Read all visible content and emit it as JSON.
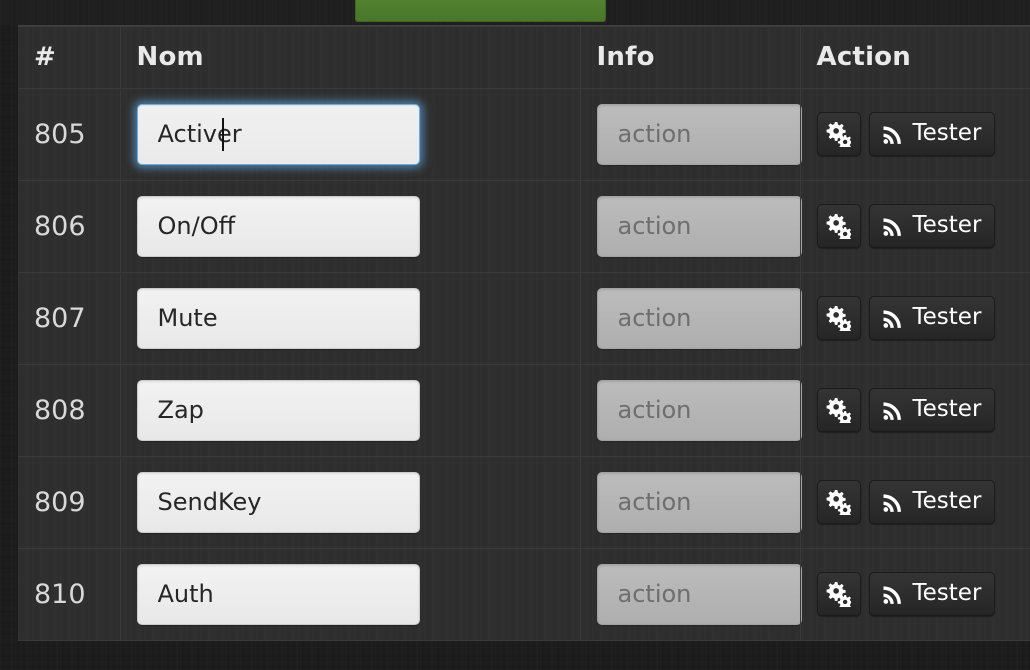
{
  "page": {
    "background_color": "#1b1b1b",
    "accent_green": "#4d7b2f",
    "focus_blue": "#66afe9"
  },
  "top_bar": {
    "green_tab_label": ""
  },
  "table": {
    "columns": [
      {
        "key": "id",
        "label": "#"
      },
      {
        "key": "nom",
        "label": "Nom"
      },
      {
        "key": "info",
        "label": "Info"
      },
      {
        "key": "action",
        "label": "Action"
      }
    ],
    "rows": [
      {
        "id": "805",
        "nom_value": "Activer",
        "nom_focused": true,
        "info_value": "",
        "info_placeholder": "action",
        "info_disabled": true,
        "settings_icon": "cogs-icon",
        "test_label": "Tester",
        "test_icon": "rss-icon"
      },
      {
        "id": "806",
        "nom_value": "On/Off",
        "nom_focused": false,
        "info_value": "",
        "info_placeholder": "action",
        "info_disabled": true,
        "settings_icon": "cogs-icon",
        "test_label": "Tester",
        "test_icon": "rss-icon"
      },
      {
        "id": "807",
        "nom_value": "Mute",
        "nom_focused": false,
        "info_value": "",
        "info_placeholder": "action",
        "info_disabled": true,
        "settings_icon": "cogs-icon",
        "test_label": "Tester",
        "test_icon": "rss-icon"
      },
      {
        "id": "808",
        "nom_value": "Zap",
        "nom_focused": false,
        "info_value": "",
        "info_placeholder": "action",
        "info_disabled": true,
        "settings_icon": "cogs-icon",
        "test_label": "Tester",
        "test_icon": "rss-icon"
      },
      {
        "id": "809",
        "nom_value": "SendKey",
        "nom_focused": false,
        "info_value": "",
        "info_placeholder": "action",
        "info_disabled": true,
        "settings_icon": "cogs-icon",
        "test_label": "Tester",
        "test_icon": "rss-icon"
      },
      {
        "id": "810",
        "nom_value": "Auth",
        "nom_focused": false,
        "info_value": "",
        "info_placeholder": "action",
        "info_disabled": true,
        "settings_icon": "cogs-icon",
        "test_label": "Tester",
        "test_icon": "rss-icon"
      }
    ]
  }
}
